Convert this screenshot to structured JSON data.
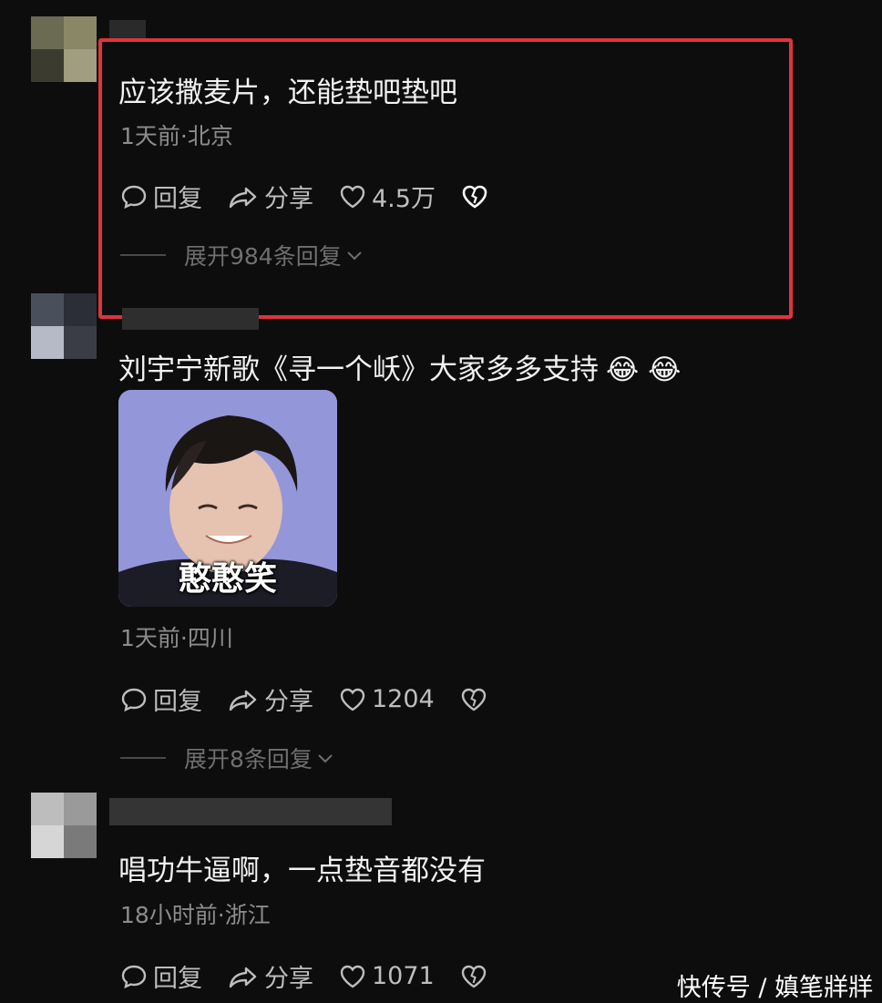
{
  "comments": [
    {
      "text": "应该撒麦片，还能垫吧垫吧",
      "meta": "1天前·北京",
      "reply_label": "回复",
      "share_label": "分享",
      "likes": "4.5万",
      "expand_label": "展开984条回复"
    },
    {
      "text": "刘宇宁新歌《寻一个岆》大家多多支持",
      "emoji": "😂 😂",
      "sticker_caption": "憨憨笑",
      "meta": "1天前·四川",
      "reply_label": "回复",
      "share_label": "分享",
      "likes": "1204",
      "expand_label": "展开8条回复"
    },
    {
      "text": "唱功牛逼啊，一点垫音都没有",
      "meta": "18小时前·浙江",
      "reply_label": "回复",
      "share_label": "分享",
      "likes": "1071"
    }
  ],
  "watermark": "快传号 / 嫃笔牂牂",
  "colors": {
    "background": "#0d0d0d",
    "highlight": "#e0343b",
    "text": "#f2f2f2",
    "meta": "#8c8c8c"
  }
}
